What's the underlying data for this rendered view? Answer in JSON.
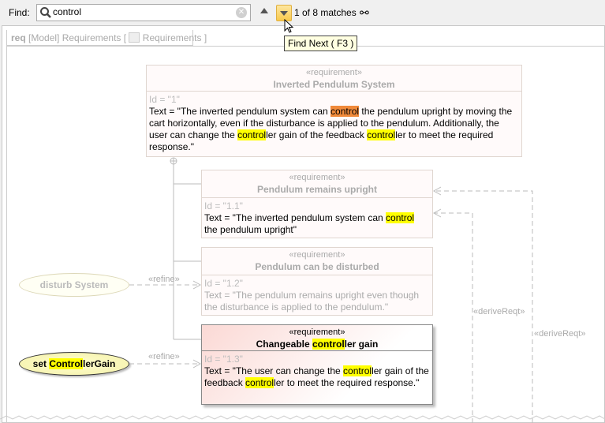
{
  "toolbar": {
    "find_label": "Find:",
    "search_value": "control",
    "match_status": "1 of 8 matches",
    "tooltip": "Find Next ( F3 )"
  },
  "frame": {
    "kind": "req",
    "label": "[Model] Requirements [",
    "diagram": "Requirements",
    "close": "]"
  },
  "requirements": [
    {
      "stereotype": "«requirement»",
      "name": "Inverted Pendulum System",
      "id": "Id = \"1\"",
      "text": [
        {
          "t": "Text = \"The inverted pendulum system can "
        },
        {
          "t": "control",
          "h": 2
        },
        {
          "t": " the pendulum upright by moving the cart horizontally, even if the disturbance is applied to the pendulum. Additionally, the user can change the "
        },
        {
          "t": "control",
          "h": 1
        },
        {
          "t": "ler gain of the feedback "
        },
        {
          "t": "control",
          "h": 1
        },
        {
          "t": "ler to meet the required response.\""
        }
      ]
    },
    {
      "stereotype": "«requirement»",
      "name": "Pendulum remains upright",
      "id": "Id = \"1.1\"",
      "text": [
        {
          "t": "Text = \"The inverted pendulum system can "
        },
        {
          "t": "control",
          "h": 1
        },
        {
          "t": " the pendulum upright\""
        }
      ]
    },
    {
      "stereotype": "«requirement»",
      "name": "Pendulum can be disturbed",
      "id": "Id = \"1.2\"",
      "text": [
        {
          "t": "Text = \"The pendulum remains upright even though the disturbance is applied to the pendulum.\""
        }
      ]
    },
    {
      "stereotype": "«requirement»",
      "name": "Changeable controller gain",
      "name_parts": [
        {
          "t": "Changeable "
        },
        {
          "t": "control",
          "h": 1
        },
        {
          "t": "ler gain"
        }
      ],
      "id": "Id = \"1.3\"",
      "text": [
        {
          "t": "Text = \"The user can change the "
        },
        {
          "t": "control",
          "h": 1
        },
        {
          "t": "ler gain of the feedback "
        },
        {
          "t": "control",
          "h": 1
        },
        {
          "t": "ler to meet the required response.\""
        }
      ]
    }
  ],
  "use_cases": [
    {
      "name": "disturb System"
    },
    {
      "name": "set ControllerGain",
      "parts": [
        {
          "t": "set "
        },
        {
          "t": "Control",
          "h": 1
        },
        {
          "t": "lerGain"
        }
      ]
    }
  ],
  "relations": {
    "refine": "«refine»",
    "derive": "«deriveReqt»"
  }
}
